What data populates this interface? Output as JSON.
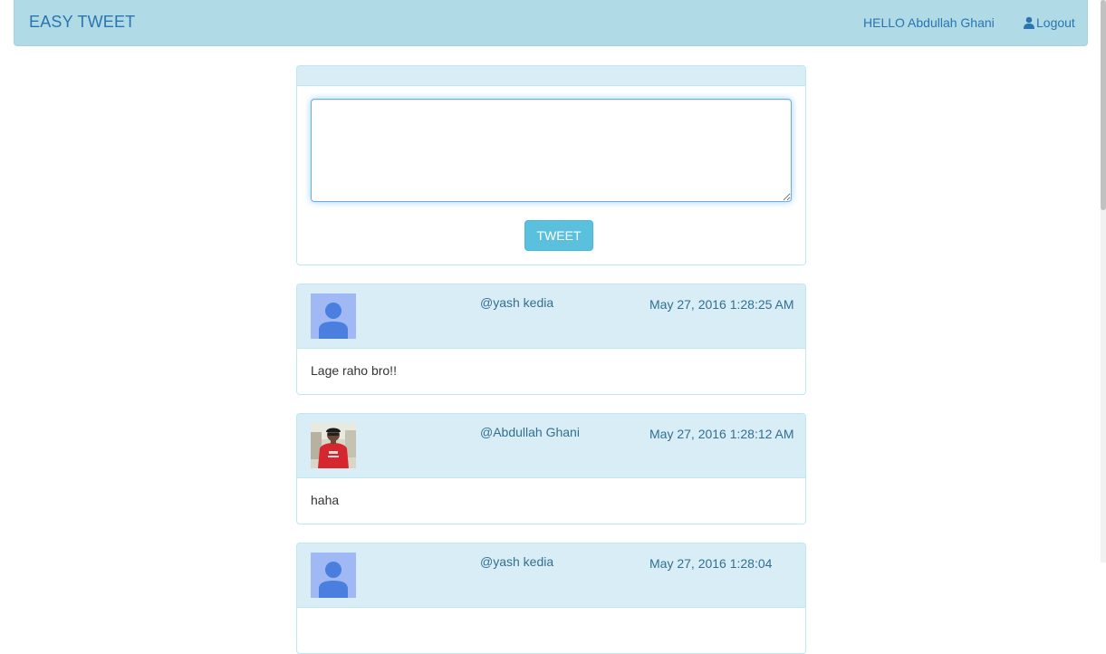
{
  "navbar": {
    "brand": "EASY TWEET",
    "greeting": "HELLO Abdullah Ghani",
    "logout_label": "Logout",
    "logout_icon": "user-icon"
  },
  "compose": {
    "textarea_value": "",
    "tweet_button_label": "TWEET"
  },
  "tweets": [
    {
      "avatar": "default-user-avatar",
      "handle": "@yash kedia",
      "timestamp": "May 27, 2016 1:28:25 AM",
      "text": "Lage raho bro!!"
    },
    {
      "avatar": "photo-avatar",
      "handle": "@Abdullah Ghani",
      "timestamp": "May 27, 2016 1:28:12 AM",
      "text": "haha"
    },
    {
      "avatar": "default-user-avatar",
      "handle": "@yash kedia",
      "timestamp": "May 27, 2016 1:28:04",
      "text": ""
    }
  ],
  "colors": {
    "navbar_bg": "#b0dbe6",
    "link": "#2a74b0",
    "panel_heading": "#d9edf7",
    "panel_border": "#bce8f1",
    "info_button": "#5bc0de",
    "heading_text": "#31708f"
  }
}
